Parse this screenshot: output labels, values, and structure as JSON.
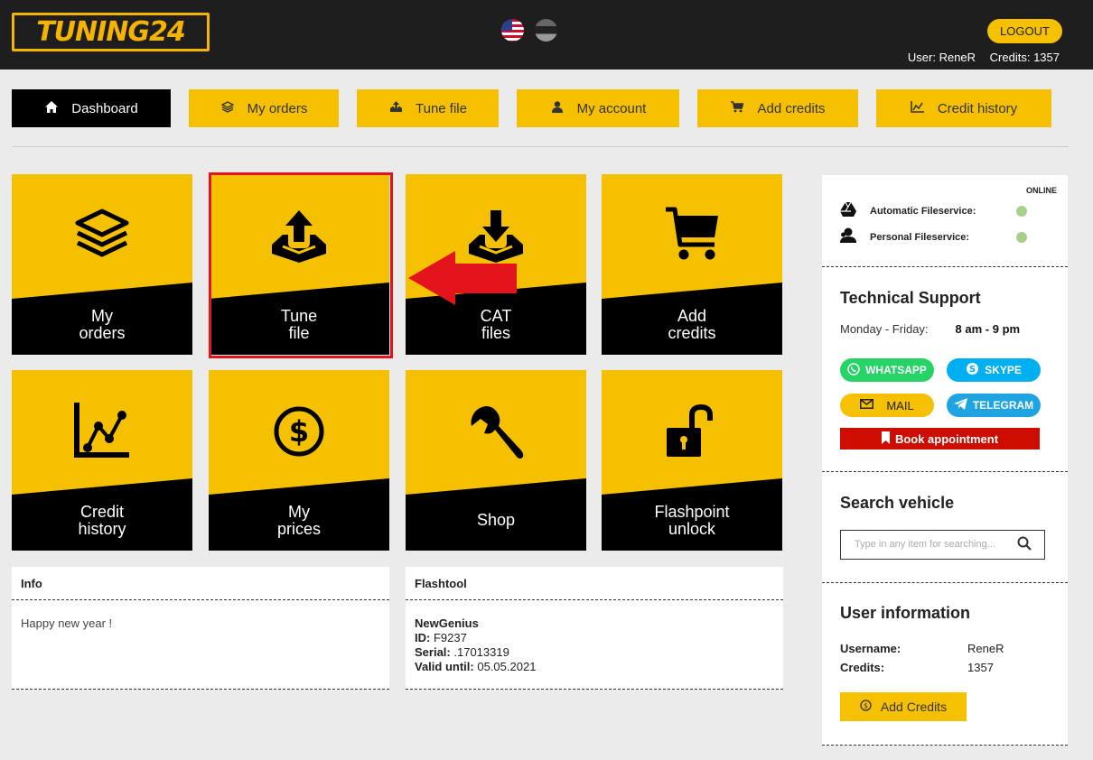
{
  "header": {
    "logo_text": "TUNING24",
    "logout_label": "LOGOUT",
    "user_text": "User: ReneR",
    "credits_text": "Credits: 1357"
  },
  "nav": [
    {
      "label": "Dashboard",
      "icon": "home-icon"
    },
    {
      "label": "My orders",
      "icon": "layers-icon"
    },
    {
      "label": "Tune file",
      "icon": "upload-icon"
    },
    {
      "label": "My account",
      "icon": "user-icon"
    },
    {
      "label": "Add credits",
      "icon": "cart-icon"
    },
    {
      "label": "Credit history",
      "icon": "chart-icon"
    }
  ],
  "tiles": [
    {
      "line1": "My",
      "line2": "orders",
      "icon": "layers-icon"
    },
    {
      "line1": "Tune",
      "line2": "file",
      "icon": "upload-icon"
    },
    {
      "line1": "CAT",
      "line2": "files",
      "icon": "download-icon"
    },
    {
      "line1": "Add",
      "line2": "credits",
      "icon": "cart-icon"
    },
    {
      "line1": "Credit",
      "line2": "history",
      "icon": "chart-icon"
    },
    {
      "line1": "My",
      "line2": "prices",
      "icon": "dollar-icon"
    },
    {
      "line1": "Shop",
      "line2": "",
      "icon": "wrench-icon"
    },
    {
      "line1": "Flashpoint",
      "line2": "unlock",
      "icon": "unlock-icon"
    }
  ],
  "info": {
    "title": "Info",
    "message": "Happy new year !"
  },
  "flashtool": {
    "title": "Flashtool",
    "name": "NewGenius",
    "id_label": "ID:",
    "id_value": "F9237",
    "serial_label": "Serial:",
    "serial_value": ".17013319",
    "valid_label": "Valid until:",
    "valid_value": "05.05.2021"
  },
  "sidebar": {
    "online_label": "ONLINE",
    "services": [
      {
        "label": "Automatic Fileservice:",
        "icon": "drive-icon",
        "status_color": "#a7d08c"
      },
      {
        "label": "Personal Fileservice:",
        "icon": "person-icon",
        "status_color": "#a7d08c"
      }
    ],
    "support_title": "Technical Support",
    "hours_days": "Monday - Friday:",
    "hours_time": "8 am - 9 pm",
    "contacts": {
      "whatsapp": "WHATSAPP",
      "skype": "SKYPE",
      "mail": "MAIL",
      "telegram": "TELEGRAM"
    },
    "book_label": "Book appointment",
    "search_title": "Search vehicle",
    "search_placeholder": "Type in any item for searching...",
    "user_info_title": "User information",
    "username_label": "Username:",
    "username_value": "ReneR",
    "credits_label": "Credits:",
    "credits_value": "1357",
    "add_credits_label": "Add Credits"
  },
  "colors": {
    "accent": "#f5c000",
    "header_bg": "#1e1e1e",
    "highlight": "#e4141c",
    "whatsapp": "#25d366",
    "skype": "#00aff0",
    "telegram": "#1ea4e0",
    "book": "#cc0d00"
  }
}
